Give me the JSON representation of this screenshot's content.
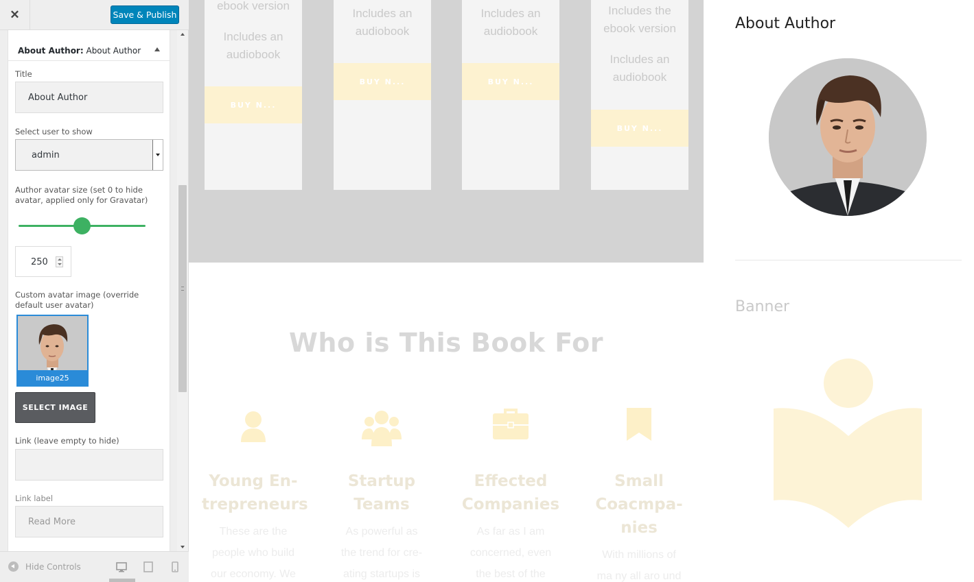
{
  "panel": {
    "close_label": "✕",
    "publish_label": "Save & Publish",
    "section": {
      "prefix": "About Author:",
      "name": "About Author"
    },
    "fields": {
      "title_label": "Title",
      "title_value": "About Author",
      "user_label": "Select user to show",
      "user_value": "admin",
      "avatar_size_label": "Author avatar size (set 0 to hide avatar, applied only for Gravatar)",
      "avatar_size_value": "250",
      "avatar_size_slider_fraction": 0.5,
      "custom_avatar_label": "Custom avatar image (override default user avatar)",
      "thumb_caption": "image25",
      "select_image_label": "SELECT IMAGE",
      "link_label": "Link (leave empty to hide)",
      "link_value": "",
      "link_text_label": "Link label",
      "link_text_value": "Read More"
    },
    "footer": {
      "hide_controls": "Hide Controls",
      "devices": [
        "desktop-icon",
        "tablet-icon",
        "mobile-icon"
      ],
      "active_device": "desktop"
    }
  },
  "preview": {
    "cards": [
      {
        "texts": [
          "ebook version",
          "Includes an",
          "audiobook"
        ],
        "buy": "BUY N..."
      },
      {
        "texts": [
          "Includes an",
          "audiobook"
        ],
        "buy": "BUY N..."
      },
      {
        "texts": [
          "Includes an",
          "audiobook"
        ],
        "buy": "BUY N..."
      },
      {
        "texts": [
          "Includes the",
          "ebook version",
          "Includes an",
          "audiobook"
        ],
        "buy": "BUY N..."
      }
    ],
    "who_title": "Who is This Book For",
    "audience": [
      {
        "icon": "user-icon",
        "name": [
          "Young En-",
          "trepreneurs"
        ],
        "desc": [
          "These are the",
          "people who build",
          "our economy. We"
        ]
      },
      {
        "icon": "group-icon",
        "name": [
          "Startup",
          "Teams"
        ],
        "desc": [
          "As powerful as",
          "the trend for cre-",
          "ating startups is"
        ]
      },
      {
        "icon": "briefcase-icon",
        "name": [
          "Effected",
          "Companies"
        ],
        "desc": [
          "As far as I am",
          "concerned, even",
          "the best of the"
        ]
      },
      {
        "icon": "bookmark-icon",
        "name": [
          "Small",
          "Coacmpa-",
          "nies"
        ],
        "desc": [
          "With millions of",
          "ma ny all aro und"
        ]
      }
    ],
    "widget_about_title": "About Author",
    "widget_banner_title": "Banner",
    "colors": {
      "accent_green": "#3db162",
      "wp_blue": "#0085ba",
      "pale_yellow": "#fdf2d0"
    }
  }
}
